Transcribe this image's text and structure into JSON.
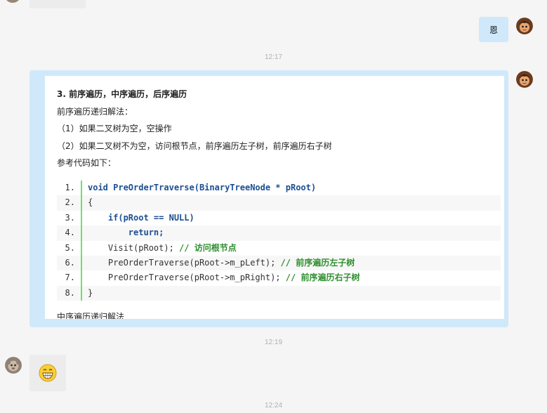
{
  "conversation": {
    "timestamps": [
      "12:17",
      "12:19",
      "12:24"
    ],
    "reply_text": "恩",
    "article": {
      "heading": "3. 前序遍历，中序遍历，后序遍历",
      "paragraphs": [
        "前序遍历递归解法：",
        "（1）如果二叉树为空，空操作",
        "（2）如果二叉树不为空，访问根节点，前序遍历左子树，前序遍历右子树",
        "参考代码如下："
      ],
      "code": [
        {
          "num": "1.",
          "code": "void PreOrderTraverse(BinaryTreeNode * pRoot)"
        },
        {
          "num": "2.",
          "code": "{"
        },
        {
          "num": "3.",
          "code": "    if(pRoot == NULL)"
        },
        {
          "num": "4.",
          "code": "        return;"
        },
        {
          "num": "5.",
          "code": "    Visit(pRoot); // 访问根节点"
        },
        {
          "num": "6.",
          "code": "    PreOrderTraverse(pRoot->m_pLeft); // 前序遍历左子树"
        },
        {
          "num": "7.",
          "code": "    PreOrderTraverse(pRoot->m_pRight); // 前序遍历右子树"
        },
        {
          "num": "8.",
          "code": "}"
        }
      ],
      "cut_off_text": "中序遍历递归解法"
    },
    "emoji_name": "grinning-face-emoji"
  }
}
